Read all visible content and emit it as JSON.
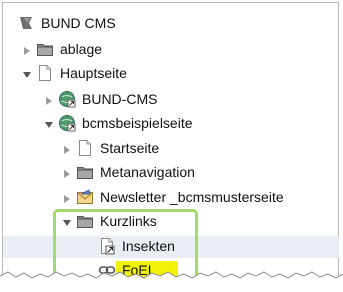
{
  "tree": {
    "root": {
      "label": "BUND CMS",
      "icon": "cms-logo-icon"
    },
    "items": [
      {
        "key": "ablage",
        "label": "ablage",
        "icon": "folder-icon",
        "expanded": false
      },
      {
        "key": "hauptseite",
        "label": "Hauptseite",
        "icon": "page-icon",
        "expanded": true
      },
      {
        "key": "bund-cms",
        "label": "BUND-CMS",
        "icon": "external-site-icon",
        "expanded": false
      },
      {
        "key": "bcmsbeispielseite",
        "label": "bcmsbeispielseite",
        "icon": "external-site-icon",
        "expanded": true
      },
      {
        "key": "startseite",
        "label": "Startseite",
        "icon": "page-icon",
        "expanded": false
      },
      {
        "key": "metanavigation",
        "label": "Metanavigation",
        "icon": "folder-icon",
        "expanded": false
      },
      {
        "key": "newsletter",
        "label": "Newsletter _bcmsmusterseite",
        "icon": "newsletter-icon",
        "expanded": false
      },
      {
        "key": "kurzlinks",
        "label": "Kurzlinks",
        "icon": "folder-icon",
        "expanded": true
      },
      {
        "key": "insekten",
        "label": "Insekten",
        "icon": "shortcut-page-icon"
      },
      {
        "key": "foei",
        "label": "FoEI",
        "icon": "link-icon"
      }
    ]
  },
  "colors": {
    "focus_box": "#a9d86a",
    "highlight": "#f1f207",
    "hover_row": "#e9eef4"
  }
}
